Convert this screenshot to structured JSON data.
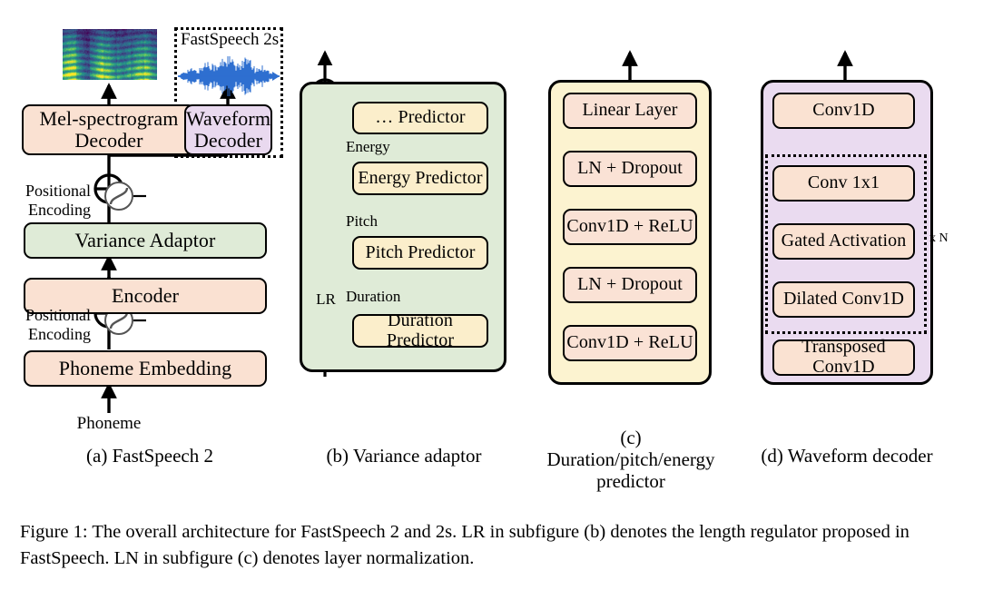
{
  "figure": {
    "caption": "Figure 1: The overall architecture for FastSpeech 2 and 2s. LR in subfigure (b) denotes the length regulator proposed in FastSpeech. LN in subfigure (c) denotes layer normalization."
  },
  "subfigure_a": {
    "caption": "(a) FastSpeech 2",
    "dotted_group_label": "FastSpeech 2s",
    "nodes": {
      "mel_decoder": "Mel-spectrogram\nDecoder",
      "waveform_decoder": "Waveform\nDecoder",
      "variance_adaptor": "Variance Adaptor",
      "encoder": "Encoder",
      "phoneme_embedding": "Phoneme Embedding"
    },
    "labels": {
      "positional_encoding_top": "Positional\nEncoding",
      "positional_encoding_bottom": "Positional\nEncoding",
      "input": "Phoneme"
    },
    "colors": {
      "peach": "#FAE1D2",
      "lavender": "#E9D9EF",
      "green": "#DFEBD7",
      "waveform": "#2E6FD0"
    }
  },
  "subfigure_b": {
    "caption": "(b) Variance adaptor",
    "nodes": {
      "extra_predictor": "… Predictor",
      "energy_predictor": "Energy Predictor",
      "pitch_predictor": "Pitch Predictor",
      "duration_predictor": "Duration Predictor"
    },
    "edge_labels": {
      "energy": "Energy",
      "pitch": "Pitch",
      "duration": "Duration"
    },
    "operators": {
      "length_regulator": "LR",
      "add": "⊕"
    },
    "colors": {
      "container": "#DFEBD7",
      "node": "#FBEECB"
    }
  },
  "subfigure_c": {
    "caption": "(c)\nDuration/pitch/energy\npredictor",
    "nodes": [
      "Linear Layer",
      "LN + Dropout",
      "Conv1D + ReLU",
      "LN + Dropout",
      "Conv1D + ReLU"
    ],
    "colors": {
      "container": "#FCF3D0",
      "node": "#FAE2D5"
    }
  },
  "subfigure_d": {
    "caption": "(d) Waveform decoder",
    "nodes": [
      "Conv1D",
      "Conv 1x1",
      "Gated Activation",
      "Dilated Conv1D",
      "Transposed Conv1D"
    ],
    "repeat_label": "x N",
    "colors": {
      "container": "#EADBF0",
      "node": "#FAE2D2"
    }
  }
}
